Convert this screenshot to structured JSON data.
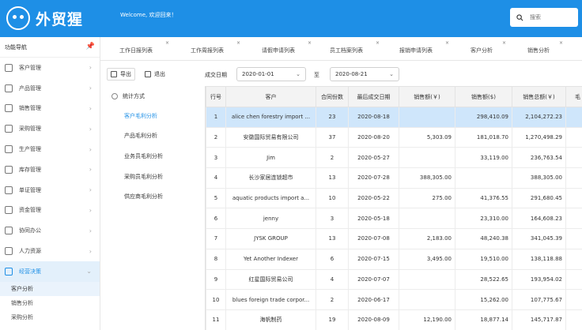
{
  "header": {
    "logo_text": "外贸猩",
    "welcome": "Welcome, 欢迎回来！",
    "search_placeholder": "搜索"
  },
  "sidebar": {
    "title": "功能导航",
    "menu": [
      {
        "label": "客户管理",
        "icon": "users-icon"
      },
      {
        "label": "产品管理",
        "icon": "box-icon"
      },
      {
        "label": "销售管理",
        "icon": "chart-icon"
      },
      {
        "label": "采购管理",
        "icon": "cart-icon"
      },
      {
        "label": "生产管理",
        "icon": "factory-icon"
      },
      {
        "label": "库存管理",
        "icon": "warehouse-icon"
      },
      {
        "label": "单证管理",
        "icon": "document-icon"
      },
      {
        "label": "资金管理",
        "icon": "money-icon"
      },
      {
        "label": "协同办公",
        "icon": "office-icon"
      },
      {
        "label": "人力资源",
        "icon": "person-icon"
      },
      {
        "label": "经营决策",
        "icon": "decision-icon"
      }
    ],
    "sub_items": [
      "客户分析",
      "销售分析",
      "采购分析"
    ]
  },
  "tabs": [
    "工作日报列表",
    "工作周报列表",
    "请假申请列表",
    "员工档案列表",
    "报销申请列表",
    "客户分析",
    "销售分析"
  ],
  "toolbar": {
    "export_label": "导出",
    "exit_label": "退出",
    "date_label": "成交日期",
    "date_from": "2020-01-01",
    "to_label": "至",
    "date_to": "2020-08-21"
  },
  "left_panel": {
    "title": "统计方式",
    "items": [
      "客户毛利分析",
      "产品毛利分析",
      "业务员毛利分析",
      "采购员毛利分析",
      "供应商毛利分析"
    ]
  },
  "table": {
    "headers": [
      "行号",
      "客户",
      "合同份数",
      "最后成交日期",
      "销售额(￥)",
      "销售额($)",
      "销售总额(￥)",
      "毛"
    ],
    "rows": [
      [
        "1",
        "alice chen forestry import ...",
        "23",
        "2020-08-18",
        "",
        "298,410.09",
        "2,104,272.23"
      ],
      [
        "2",
        "安徽国际贸易有限公司",
        "37",
        "2020-08-20",
        "5,303.09",
        "181,018.70",
        "1,270,498.29"
      ],
      [
        "3",
        "Jim",
        "2",
        "2020-05-27",
        "",
        "33,119.00",
        "236,763.54"
      ],
      [
        "4",
        "长沙家居连锁超市",
        "13",
        "2020-07-28",
        "388,305.00",
        "",
        "388,305.00"
      ],
      [
        "5",
        "aquatic products import a...",
        "10",
        "2020-05-22",
        "275.00",
        "41,376.55",
        "291,680.45"
      ],
      [
        "6",
        "jenny",
        "3",
        "2020-05-18",
        "",
        "23,310.00",
        "164,608.23"
      ],
      [
        "7",
        "JYSK GROUP",
        "13",
        "2020-07-08",
        "2,183.00",
        "48,240.38",
        "341,045.39"
      ],
      [
        "8",
        "Yet Another Indexer",
        "6",
        "2020-07-15",
        "3,495.00",
        "19,510.00",
        "138,118.88"
      ],
      [
        "9",
        "红星国际贸易公司",
        "4",
        "2020-07-07",
        "",
        "28,522.65",
        "193,954.02"
      ],
      [
        "10",
        "blues foreign trade corpor...",
        "2",
        "2020-06-17",
        "",
        "15,262.00",
        "107,775.67"
      ],
      [
        "11",
        "海帆制药",
        "19",
        "2020-08-09",
        "12,190.00",
        "18,877.14",
        "145,717.87"
      ]
    ]
  },
  "colors": {
    "accent": "#1e8fe6",
    "selected_row": "#cfe6fb"
  }
}
